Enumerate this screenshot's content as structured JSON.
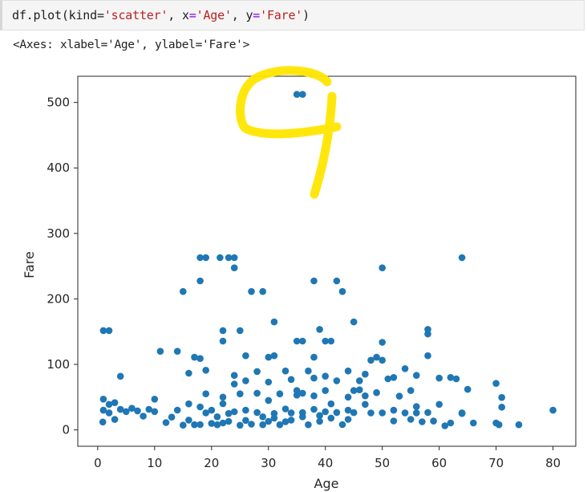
{
  "cell": {
    "code_prefix": "df.plot(kind=",
    "code_kind": "'scatter'",
    "code_mid1": ", x",
    "code_eq1": "=",
    "code_x": "'Age'",
    "code_mid2": ", y",
    "code_eq2": "=",
    "code_y": "'Fare'",
    "code_suffix": ")",
    "output": "<Axes: xlabel='Age', ylabel='Fare'>"
  },
  "colors": {
    "marker": "#1f77b4",
    "annotation": "#ffe600"
  },
  "annotation": {
    "type": "handwritten-digit",
    "icon": "handwritten-9-annotation"
  },
  "chart_data": {
    "type": "scatter",
    "xlabel": "Age",
    "ylabel": "Fare",
    "xlim": [
      -3.5,
      84
    ],
    "ylim": [
      -25,
      540
    ],
    "xticks": [
      0,
      10,
      20,
      30,
      40,
      50,
      60,
      70,
      80
    ],
    "yticks": [
      0,
      100,
      200,
      300,
      400,
      500
    ],
    "grid": false,
    "points": [
      [
        35,
        512.3
      ],
      [
        36,
        512.3
      ],
      [
        18,
        263
      ],
      [
        19,
        263
      ],
      [
        21.5,
        263
      ],
      [
        23,
        263
      ],
      [
        24,
        263
      ],
      [
        64,
        263
      ],
      [
        24,
        247.5
      ],
      [
        50,
        247.5
      ],
      [
        18,
        227.5
      ],
      [
        38,
        227.5
      ],
      [
        42,
        227.5
      ],
      [
        15,
        211.3
      ],
      [
        27,
        211.3
      ],
      [
        29,
        211.3
      ],
      [
        43,
        211.3
      ],
      [
        31,
        164.9
      ],
      [
        45,
        164.9
      ],
      [
        1,
        151.6
      ],
      [
        2,
        151.6
      ],
      [
        22,
        151.6
      ],
      [
        25,
        151.6
      ],
      [
        58,
        153.5
      ],
      [
        39,
        153.5
      ],
      [
        22,
        135.6
      ],
      [
        35,
        135.6
      ],
      [
        36,
        135.6
      ],
      [
        40,
        135.6
      ],
      [
        41,
        135.6
      ],
      [
        50,
        133.7
      ],
      [
        58,
        146.5
      ],
      [
        11,
        120
      ],
      [
        14,
        120
      ],
      [
        26,
        113.3
      ],
      [
        30,
        110.9
      ],
      [
        31,
        113.3
      ],
      [
        17,
        110.9
      ],
      [
        18,
        108.9
      ],
      [
        38,
        110.9
      ],
      [
        49,
        110.9
      ],
      [
        58,
        113.3
      ],
      [
        4,
        81.9
      ],
      [
        16,
        86.5
      ],
      [
        19,
        91.1
      ],
      [
        24,
        83.2
      ],
      [
        28,
        89.1
      ],
      [
        33,
        90
      ],
      [
        37,
        90
      ],
      [
        44,
        90
      ],
      [
        48,
        106.4
      ],
      [
        50,
        106.4
      ],
      [
        54,
        93.5
      ],
      [
        56,
        83.2
      ],
      [
        70,
        71
      ],
      [
        0.9,
        12
      ],
      [
        1,
        30
      ],
      [
        1,
        46.9
      ],
      [
        2,
        39
      ],
      [
        2,
        26
      ],
      [
        3,
        41.6
      ],
      [
        3,
        15.9
      ],
      [
        4,
        31.3
      ],
      [
        5,
        27.9
      ],
      [
        6,
        33
      ],
      [
        7,
        29.1
      ],
      [
        8,
        21
      ],
      [
        9,
        31.4
      ],
      [
        10,
        46.9
      ],
      [
        10,
        27.9
      ],
      [
        12,
        11.2
      ],
      [
        13,
        19.5
      ],
      [
        14,
        30.1
      ],
      [
        15,
        7.2
      ],
      [
        16,
        39.7
      ],
      [
        17,
        7.9
      ],
      [
        18,
        8.1
      ],
      [
        19,
        26
      ],
      [
        20,
        9.8
      ],
      [
        21,
        7.8
      ],
      [
        22,
        10.5
      ],
      [
        23,
        13
      ],
      [
        24,
        27.7
      ],
      [
        25,
        7.1
      ],
      [
        26,
        14.5
      ],
      [
        27,
        8.7
      ],
      [
        28,
        26.6
      ],
      [
        29,
        7.9
      ],
      [
        30,
        13
      ],
      [
        31,
        18
      ],
      [
        32,
        7.9
      ],
      [
        33,
        12.5
      ],
      [
        34,
        26
      ],
      [
        35,
        53.1
      ],
      [
        36,
        26.3
      ],
      [
        37,
        7.9
      ],
      [
        38,
        31.4
      ],
      [
        39,
        13
      ],
      [
        40,
        27.7
      ],
      [
        41,
        39.7
      ],
      [
        42,
        26.6
      ],
      [
        43,
        8.1
      ],
      [
        44,
        16.1
      ],
      [
        45,
        26.3
      ],
      [
        46,
        61.2
      ],
      [
        47,
        52
      ],
      [
        48,
        25.9
      ],
      [
        49,
        56.9
      ],
      [
        50,
        26
      ],
      [
        51,
        77.9
      ],
      [
        52,
        13.6
      ],
      [
        53,
        51.5
      ],
      [
        54,
        26
      ],
      [
        55,
        16
      ],
      [
        56,
        35.5
      ],
      [
        57,
        12.4
      ],
      [
        58,
        26.6
      ],
      [
        59,
        13.5
      ],
      [
        60,
        39
      ],
      [
        61,
        6.2
      ],
      [
        62,
        10.5
      ],
      [
        63,
        77.9
      ],
      [
        64,
        26
      ],
      [
        65,
        61.9
      ],
      [
        66,
        10.5
      ],
      [
        70,
        10.5
      ],
      [
        70.5,
        7.8
      ],
      [
        71,
        49.5
      ],
      [
        71,
        34.7
      ],
      [
        74,
        7.8
      ],
      [
        80,
        30
      ],
      [
        20,
        30
      ],
      [
        22,
        50
      ],
      [
        25,
        55
      ],
      [
        28,
        56
      ],
      [
        30,
        45
      ],
      [
        32,
        55
      ],
      [
        35,
        60
      ],
      [
        38,
        52
      ],
      [
        40,
        60
      ],
      [
        42,
        75
      ],
      [
        45,
        60
      ],
      [
        46,
        75
      ],
      [
        47,
        85
      ],
      [
        52,
        80
      ],
      [
        55,
        60
      ],
      [
        21,
        20
      ],
      [
        23,
        25
      ],
      [
        26,
        30
      ],
      [
        29,
        20
      ],
      [
        31,
        25
      ],
      [
        33,
        32
      ],
      [
        34,
        15
      ],
      [
        36,
        20
      ],
      [
        39,
        22
      ],
      [
        41,
        18
      ],
      [
        44,
        30
      ],
      [
        18,
        35
      ],
      [
        16,
        15
      ],
      [
        19,
        55
      ],
      [
        22,
        40
      ],
      [
        24,
        70
      ],
      [
        26,
        75
      ],
      [
        30,
        73
      ],
      [
        34,
        77
      ],
      [
        36,
        56
      ],
      [
        38,
        79
      ],
      [
        40,
        82
      ],
      [
        47,
        39
      ],
      [
        52,
        30
      ],
      [
        56,
        26
      ],
      [
        60,
        79
      ],
      [
        62,
        80
      ],
      [
        64,
        25
      ],
      [
        44,
        50
      ]
    ]
  }
}
